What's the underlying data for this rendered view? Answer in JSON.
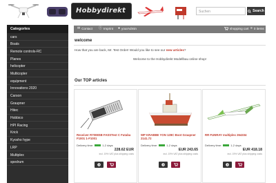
{
  "header": {
    "logo_text": "Hobbydirekt",
    "search": {
      "placeholder": "Suchen",
      "button_label": "Search"
    }
  },
  "sidebar": {
    "title": "Categories",
    "items": [
      "cars",
      "Boats",
      "Remote controls-RC",
      "Planes",
      "helicopter",
      "Multicopter",
      "equipment",
      "Innovations 2020",
      "Carson",
      "Graupner",
      "Hitec",
      "Hobbico",
      "HPI Racing",
      "Krick",
      "Kyosho hype",
      "LRP",
      "Multiplex",
      "spedrum"
    ]
  },
  "topbar": {
    "contact": "Contact",
    "imprint": "Imprint",
    "account": "yourAdmin",
    "cart": "shopping cart",
    "items": "0 items"
  },
  "welcome": {
    "title": "welcome",
    "text_prefix": "How that you are back, Mr. Test Order! Would you like to see our",
    "link": "new articles",
    "text_suffix": "?",
    "subtext": "Welcome to the Hobbydirekt Modellbau online shop!"
  },
  "top_articles": {
    "title": "Our TOP articles",
    "delivery_label": "Delivery time:",
    "products": [
      {
        "name": "Receiver R7008SB FASSTest C Futaba F1001 1-F1001",
        "delivery": "1-2 days",
        "price": "228.62 EUR",
        "tax": "incl. 19% VAT plus shipping costs"
      },
      {
        "name": "WP KRABBE YON 128C Boot Graupner 2141.72",
        "delivery": "1-2 days",
        "price": "EUR 243.65",
        "tax": "incl. 19% VAT plus shipping costs"
      },
      {
        "name": "RR FUNRAY multiplex 264334",
        "delivery": "1-2 days",
        "price": "EUR 418.18",
        "tax": "incl. 19% VAT plus shipping costs"
      }
    ]
  },
  "colors": {
    "accent": "#c0392b",
    "sidebar_bg": "#2e2e2e",
    "topbar_bg": "#7a7a7a",
    "cart_button": "#8b1a3a",
    "delivery_green": "#3aa83a"
  }
}
